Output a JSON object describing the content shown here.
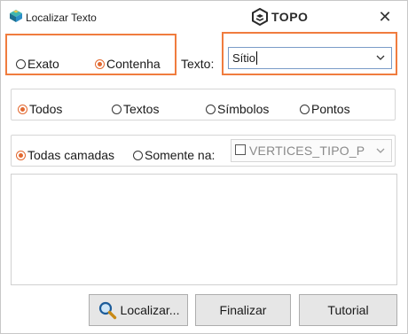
{
  "window": {
    "title": "Localizar Texto",
    "brand": "TOPO",
    "close_glyph": "✕"
  },
  "match_mode": {
    "options": [
      {
        "label": "Exato",
        "selected": false
      },
      {
        "label": "Contenha",
        "selected": true
      }
    ]
  },
  "text_search": {
    "label": "Texto:",
    "value": "Sítio"
  },
  "scope": {
    "options": [
      {
        "label": "Todos",
        "selected": true
      },
      {
        "label": "Textos",
        "selected": false
      },
      {
        "label": "Símbolos",
        "selected": false
      },
      {
        "label": "Pontos",
        "selected": false
      }
    ]
  },
  "layers": {
    "options": [
      {
        "label": "Todas camadas",
        "selected": true
      },
      {
        "label": "Somente na:",
        "selected": false
      }
    ],
    "selected_layer": "VERTICES_TIPO_P",
    "checked": false
  },
  "buttons": {
    "search": "Localizar...",
    "finish": "Finalizar",
    "tutorial": "Tutorial"
  },
  "colors": {
    "accent": "#f07c3e",
    "radio_selected": "#e2682f",
    "button_bg": "#e6e6e6"
  }
}
